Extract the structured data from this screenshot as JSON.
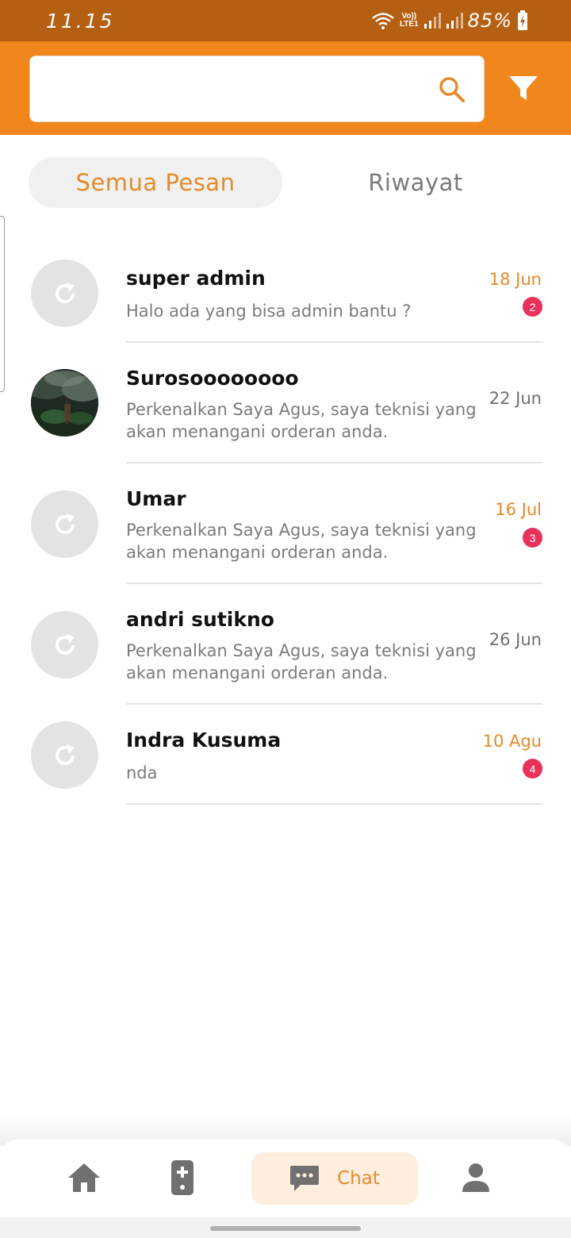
{
  "status_bar": {
    "time": "11.15",
    "volte_top": "Vo))",
    "volte_bottom": "LTE1",
    "battery": "85%"
  },
  "search": {
    "placeholder": "",
    "value": "",
    "icon": "search-icon"
  },
  "filter": {
    "icon": "filter-icon"
  },
  "tabs": [
    {
      "label": "Semua Pesan",
      "active": true
    },
    {
      "label": "Riwayat",
      "active": false
    }
  ],
  "chats": [
    {
      "name": "super admin",
      "message": "Halo ada yang bisa admin bantu ?",
      "date": "18 Jun",
      "unread": "2",
      "avatar": "refresh-icon"
    },
    {
      "name": "Surosoooooooo",
      "message": "Perkenalkan Saya Agus, saya teknisi yang akan menangani orderan anda.",
      "date": "22 Jun",
      "unread": "",
      "avatar": "photo"
    },
    {
      "name": "Umar",
      "message": "Perkenalkan Saya Agus, saya teknisi yang akan menangani orderan anda.",
      "date": "16 Jul",
      "unread": "3",
      "avatar": "refresh-icon"
    },
    {
      "name": "andri sutikno",
      "message": "Perkenalkan Saya Agus, saya teknisi yang akan menangani orderan anda.",
      "date": "26 Jun",
      "unread": "",
      "avatar": "refresh-icon"
    },
    {
      "name": "Indra Kusuma",
      "message": "nda",
      "date": "10 Agu",
      "unread": "4",
      "avatar": "refresh-icon"
    }
  ],
  "bottom_nav": {
    "items": [
      {
        "icon": "home-icon"
      },
      {
        "icon": "service-device-icon"
      },
      {
        "icon": "chat-bubble-icon",
        "label": "Chat",
        "active": true
      },
      {
        "icon": "person-icon"
      }
    ]
  },
  "colors": {
    "status_bar": "#b55f13",
    "header": "#f0861c",
    "accent": "#e48a2a",
    "badge": "#e8315b",
    "nav_active_bg": "#fdeedd"
  }
}
